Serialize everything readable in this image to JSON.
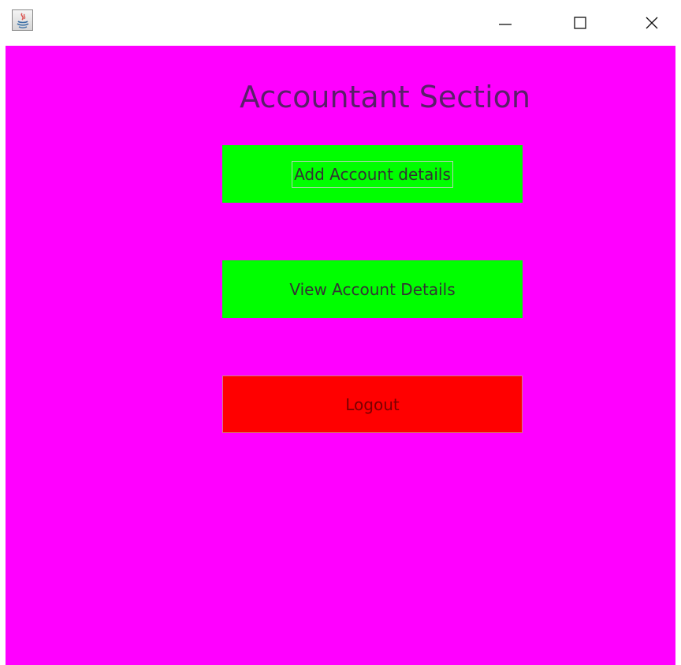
{
  "window": {
    "icon": "java-app-icon",
    "controls": {
      "minimize": "minimize-icon",
      "maximize": "maximize-icon",
      "close": "close-icon"
    }
  },
  "main": {
    "title": "Accountant Section",
    "buttons": {
      "add": "Add Account details",
      "view": "View Account Details",
      "logout": "Logout"
    }
  },
  "colors": {
    "background": "#ff00ff",
    "primary_button": "#00ff00",
    "logout_button": "#ff0000",
    "title_text": "#5a1f6a"
  }
}
